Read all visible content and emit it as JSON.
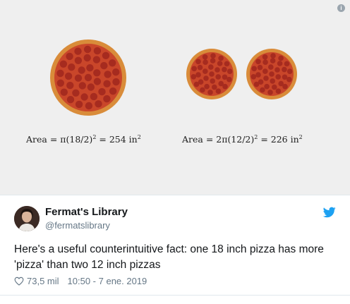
{
  "media": {
    "formula_left": "Area = π(18/2)",
    "formula_left_exp": "2",
    "formula_left_rest": " = 254 in",
    "formula_left_unit_exp": "2",
    "formula_right": "Area = 2π(12/2)",
    "formula_right_exp": "2",
    "formula_right_rest": " = 226 in",
    "formula_right_unit_exp": "2",
    "info_glyph": "i",
    "colors": {
      "background": "#efefef",
      "crust": "#d98c3a",
      "sauce": "#c9462a",
      "pepperoni": "#a62b1f"
    }
  },
  "tweet": {
    "display_name": "Fermat's Library",
    "handle": "@fermatslibrary",
    "text": "Here's a useful counterintuitive fact: one 18 inch pizza has more 'pizza' than two 12 inch pizzas",
    "likes": "73,5 mil",
    "timestamp": "10:50 - 7 ene. 2019",
    "brand_color": "#1da1f2"
  }
}
